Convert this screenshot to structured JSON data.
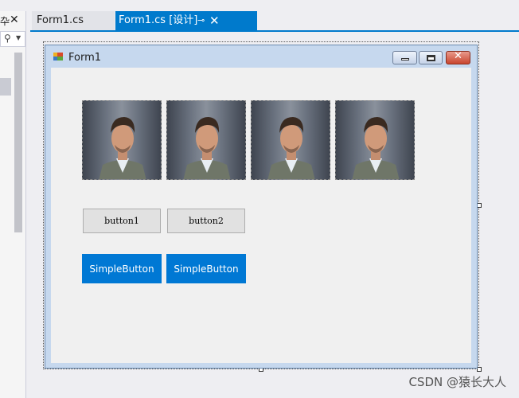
{
  "left_panel": {
    "pin_glyph": "卆",
    "close_glyph": "✕"
  },
  "tabs": [
    {
      "label": "Form1.cs",
      "active": false
    },
    {
      "label": "Form1.cs [设计]",
      "active": true
    }
  ],
  "form": {
    "title": "Form1",
    "picture_boxes": 4,
    "buttons": [
      {
        "label": "button1"
      },
      {
        "label": "button2"
      }
    ],
    "simple_buttons": [
      {
        "label": "SimpleButton"
      },
      {
        "label": "SimpleButton"
      }
    ]
  },
  "watermark": "CSDN @猿长大人",
  "colors": {
    "accent": "#007acc",
    "simple_button": "#0078d4"
  }
}
